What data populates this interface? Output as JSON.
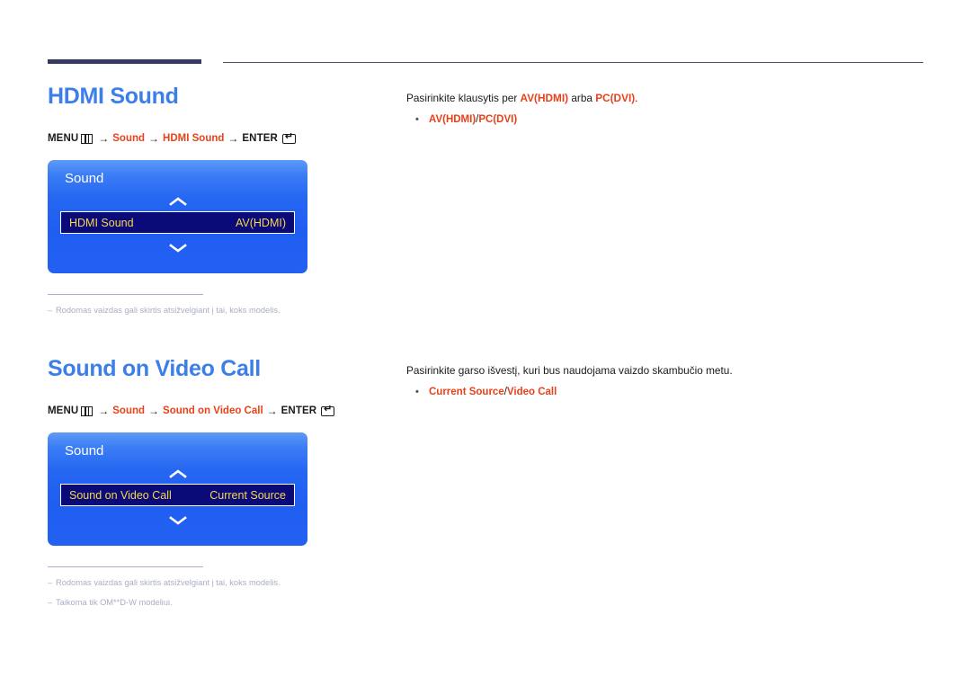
{
  "header": {
    "rule_thick_color": "#353b5e",
    "rule_thin_color": "#4a4f70"
  },
  "theme": {
    "heading_blue": "#3d7fe8",
    "accent_orange": "#e8411a",
    "osd_blue": "#2160f1",
    "osd_row_navy": "#0a0a78",
    "osd_row_text": "#f7d94e",
    "note_gray": "#a9aec6"
  },
  "sections": [
    {
      "title": "HDMI Sound",
      "path": {
        "menu_label": "MENU",
        "menu_icon": "menu-grid-icon",
        "steps": [
          "Sound",
          "HDMI Sound"
        ],
        "enter_label": "ENTER",
        "enter_icon": "enter-return-icon",
        "arrow": "→"
      },
      "osd": {
        "title": "Sound",
        "chevron_up_icon": "chevron-up-icon",
        "chevron_down_icon": "chevron-down-icon",
        "row_name": "HDMI Sound",
        "row_value": "AV(HDMI)"
      },
      "notes": [
        "Rodomas vaizdas gali skirtis atsižvelgiant į tai, koks modelis."
      ],
      "desc_parts": [
        {
          "text": "Pasirinkite klausytis per ",
          "hl": false
        },
        {
          "text": "AV(HDMI)",
          "hl": true
        },
        {
          "text": " arba ",
          "hl": false
        },
        {
          "text": "PC(DVI)",
          "hl": true
        },
        {
          "text": ".",
          "hl": false
        }
      ],
      "bullets": [
        {
          "left": "AV(HDMI)",
          "sep": " / ",
          "right": "PC(DVI)"
        }
      ]
    },
    {
      "title": "Sound on Video Call",
      "path": {
        "menu_label": "MENU",
        "menu_icon": "menu-grid-icon",
        "steps": [
          "Sound",
          "Sound on Video Call"
        ],
        "enter_label": "ENTER",
        "enter_icon": "enter-return-icon",
        "arrow": "→"
      },
      "osd": {
        "title": "Sound",
        "chevron_up_icon": "chevron-up-icon",
        "chevron_down_icon": "chevron-down-icon",
        "row_name": "Sound on Video Call",
        "row_value": "Current Source"
      },
      "notes": [
        "Rodomas vaizdas gali skirtis atsižvelgiant į tai, koks modelis.",
        "Taikoma tik OM**D-W modeliui."
      ],
      "desc_parts": [
        {
          "text": "Pasirinkite garso išvestį, kuri bus naudojama vaizdo skambučio metu.",
          "hl": false
        }
      ],
      "bullets": [
        {
          "left": "Current Source",
          "sep": " / ",
          "right": "Video Call"
        }
      ]
    }
  ]
}
